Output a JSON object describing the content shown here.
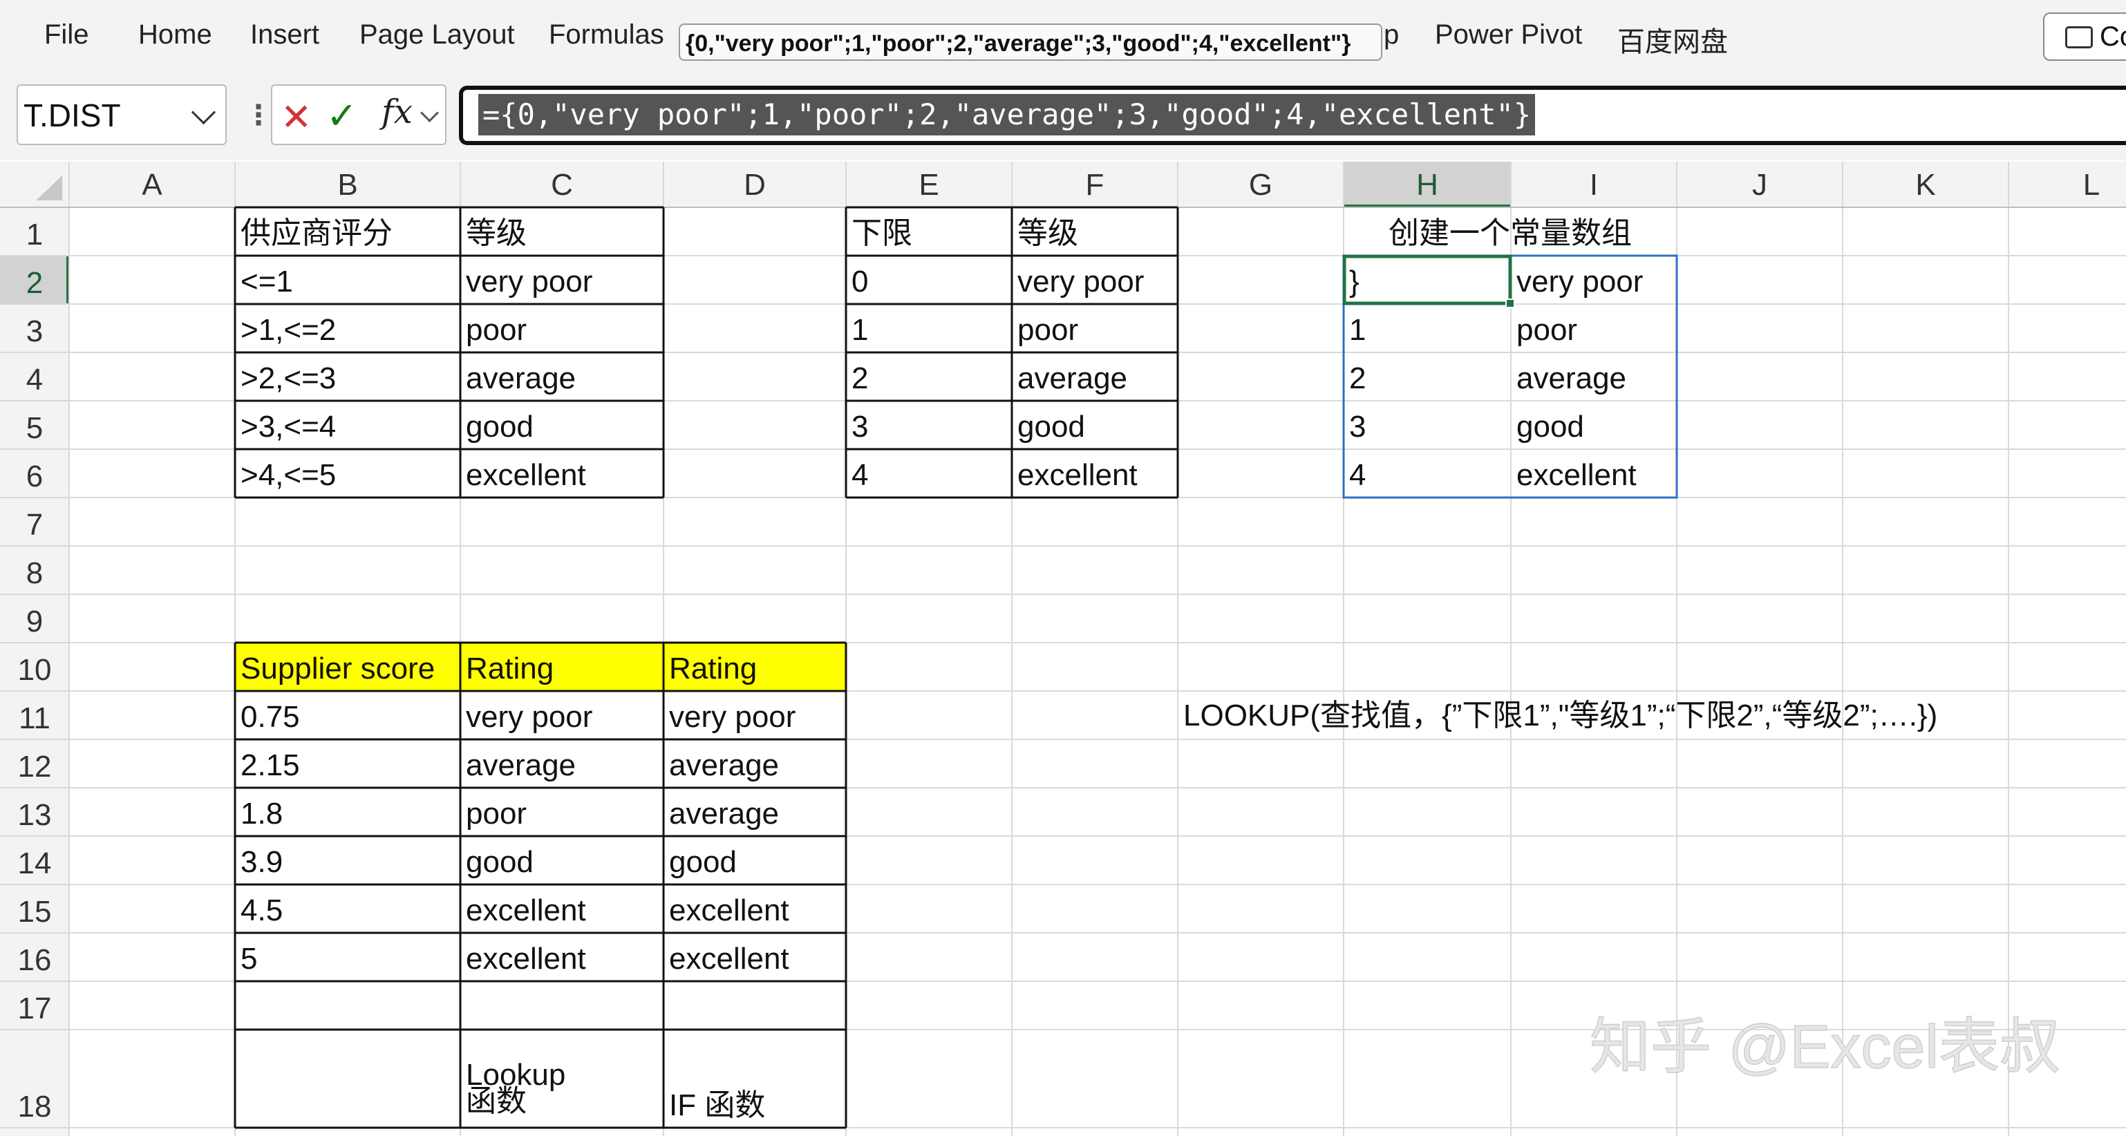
{
  "ribbon": {
    "tabs": [
      "File",
      "Home",
      "Insert",
      "Page Layout",
      "Formulas",
      "p",
      "Power Pivot",
      "百度网盘"
    ],
    "tooltip": "{0,\"very poor\";1,\"poor\";2,\"average\";3,\"good\";4,\"excellent\"}",
    "comments_label": "Co"
  },
  "formula_bar": {
    "name_box": "T.DIST",
    "formula": "={0,\"very poor\";1,\"poor\";2,\"average\";3,\"good\";4,\"excellent\"}"
  },
  "sheet": {
    "columns": [
      "A",
      "B",
      "C",
      "D",
      "E",
      "F",
      "G",
      "H",
      "I",
      "J",
      "K",
      "L"
    ],
    "rows": [
      "1",
      "2",
      "3",
      "4",
      "5",
      "6",
      "7",
      "8",
      "9",
      "10",
      "11",
      "12",
      "13",
      "14",
      "15",
      "16",
      "17",
      "18"
    ],
    "active_column": "H",
    "active_row": "2",
    "colors": {
      "header_yellow": "#ffff00",
      "selection_green": "#217346",
      "range_blue": "#2f6fc9"
    },
    "cells": {
      "B1": "供应商评分",
      "C1": "等级",
      "B2": "<=1",
      "C2": "very poor",
      "B3": ">1,<=2",
      "C3": "poor",
      "B4": ">2,<=3",
      "C4": "average",
      "B5": ">3,<=4",
      "C5": "good",
      "B6": ">4,<=5",
      "C6": "excellent",
      "E1": "下限",
      "F1": "等级",
      "E2": "0",
      "F2": "very poor",
      "E3": "1",
      "F3": "poor",
      "E4": "2",
      "F4": "average",
      "E5": "3",
      "F5": "good",
      "E6": "4",
      "F6": "excellent",
      "H1": "创建一个常量数组",
      "H2": "}",
      "I2": "very poor",
      "H3": "1",
      "I3": "poor",
      "H4": "2",
      "I4": "average",
      "H5": "3",
      "I5": "good",
      "H6": "4",
      "I6": "excellent",
      "B10": "Supplier score",
      "C10": "Rating",
      "D10": "Rating",
      "B11": "0.75",
      "C11": "very poor",
      "D11": "very poor",
      "B12": "2.15",
      "C12": "average",
      "D12": "average",
      "B13": "1.8",
      "C13": "poor",
      "D13": "average",
      "B14": "3.9",
      "C14": "good",
      "D14": "good",
      "B15": "4.5",
      "C15": "excellent",
      "D15": "excellent",
      "B16": "5",
      "C16": "excellent",
      "D16": "excellent",
      "C18a": "Lookup",
      "C18b": "函数",
      "D18": "IF 函数",
      "G11": "LOOKUP(查找值，{”下限1”,\"等级1”;“下限2”,“等级2”;….})"
    }
  },
  "watermark": "知乎 @Excel表叔"
}
